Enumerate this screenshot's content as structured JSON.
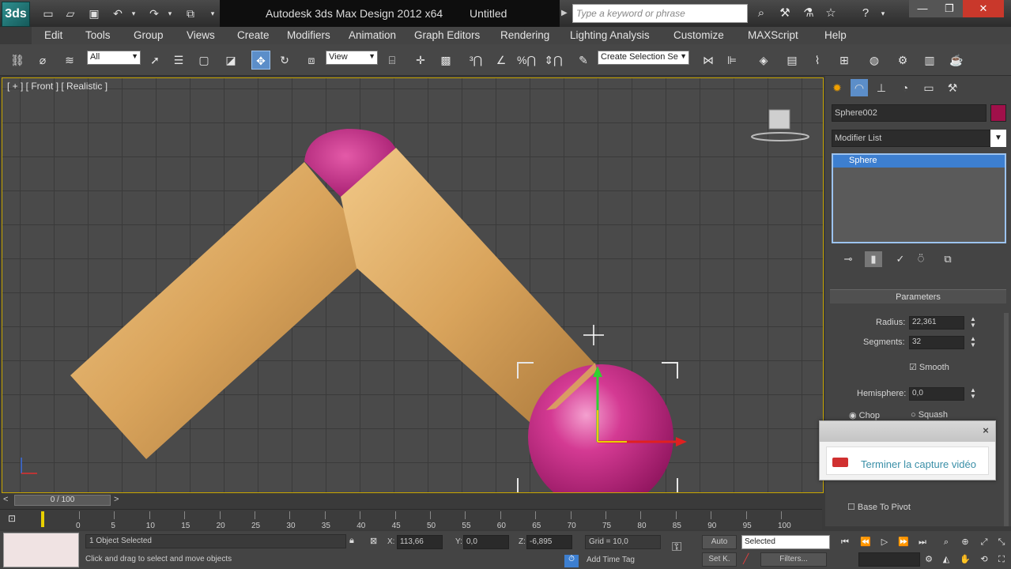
{
  "app": {
    "title": "Autodesk 3ds Max Design 2012 x64",
    "document": "Untitled",
    "logo": "3ds",
    "search_placeholder": "Type a keyword or phrase"
  },
  "menu": [
    "Edit",
    "Tools",
    "Group",
    "Views",
    "Create",
    "Modifiers",
    "Animation",
    "Graph Editors",
    "Rendering",
    "Lighting Analysis",
    "Customize",
    "MAXScript",
    "Help"
  ],
  "toolbar": {
    "selection_filter": "All",
    "reference_coord": "View",
    "named_selection": "Create Selection Se"
  },
  "viewport": {
    "label": "[ + ] [ Front ] [ Realistic ]",
    "accent_color": "#c8a600",
    "cylinder_color": "#d9a45c",
    "sphere_color": "#c0247e"
  },
  "command_panel": {
    "object_name": "Sphere002",
    "object_color": "#a0104a",
    "modifier_list": "Modifier List",
    "stack_item": "Sphere",
    "rollout_title": "Parameters",
    "radius_label": "Radius:",
    "radius_value": "22,361",
    "segments_label": "Segments:",
    "segments_value": "32",
    "smooth_label": "Smooth",
    "hemisphere_label": "Hemisphere:",
    "hemisphere_value": "0,0",
    "chop_label": "Chop",
    "squash_label": "Squash",
    "base_to_pivot_label": "Base To Pivot"
  },
  "notification": {
    "text": "Terminer la capture vidéo",
    "close": "×"
  },
  "timeline": {
    "frame_display": "0 / 100",
    "ticks": [
      "0",
      "5",
      "10",
      "15",
      "20",
      "25",
      "30",
      "35",
      "40",
      "45",
      "50",
      "55",
      "60",
      "65",
      "70",
      "75",
      "80",
      "85",
      "90",
      "95",
      "100"
    ]
  },
  "status": {
    "selection": "1 Object Selected",
    "prompt": "Click and drag to select and move objects",
    "x_label": "X:",
    "x_value": "113,66",
    "y_label": "Y:",
    "y_value": "0,0",
    "z_label": "Z:",
    "z_value": "-6,895",
    "grid": "Grid = 10,0",
    "add_time_tag": "Add Time Tag",
    "auto_key": "Auto",
    "set_key": "Set K.",
    "key_filter": "Selected",
    "filters": "Filters..."
  }
}
